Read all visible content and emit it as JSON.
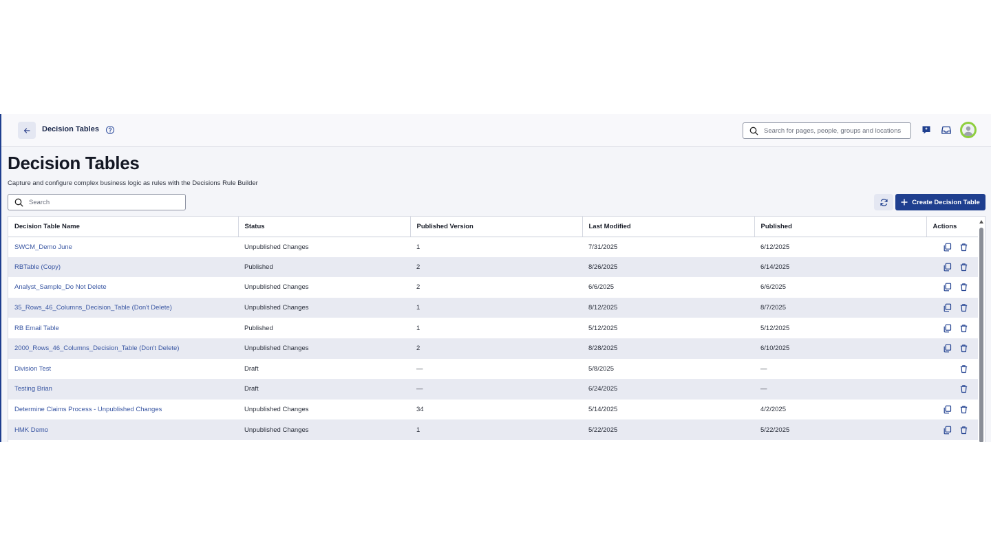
{
  "header": {
    "title": "Decision Tables",
    "search_placeholder": "Search for pages, people, groups and locations"
  },
  "page": {
    "title": "Decision Tables",
    "subtitle": "Capture and configure complex business logic as rules with the Decisions Rule Builder",
    "search_placeholder": "Search",
    "create_label": "Create Decision Table"
  },
  "table": {
    "columns": [
      "Decision Table Name",
      "Status",
      "Published Version",
      "Last Modified",
      "Published",
      "Actions"
    ],
    "rows": [
      {
        "name": "SWCM_Demo June",
        "status": "Unpublished Changes",
        "version": "1",
        "modified": "7/31/2025",
        "published": "6/12/2025",
        "copy": true
      },
      {
        "name": "RBTable (Copy)",
        "status": "Published",
        "version": "2",
        "modified": "8/26/2025",
        "published": "6/14/2025",
        "copy": true
      },
      {
        "name": "Analyst_Sample_Do Not Delete",
        "status": "Unpublished Changes",
        "version": "2",
        "modified": "6/6/2025",
        "published": "6/6/2025",
        "copy": true
      },
      {
        "name": "35_Rows_46_Columns_Decision_Table (Don't Delete)",
        "status": "Unpublished Changes",
        "version": "1",
        "modified": "8/12/2025",
        "published": "8/7/2025",
        "copy": true
      },
      {
        "name": "RB Email Table",
        "status": "Published",
        "version": "1",
        "modified": "5/12/2025",
        "published": "5/12/2025",
        "copy": true
      },
      {
        "name": "2000_Rows_46_Columns_Decision_Table (Don't Delete)",
        "status": "Unpublished Changes",
        "version": "2",
        "modified": "8/28/2025",
        "published": "6/10/2025",
        "copy": true
      },
      {
        "name": "Division Test",
        "status": "Draft",
        "version": "—",
        "modified": "5/8/2025",
        "published": "—",
        "copy": false
      },
      {
        "name": "Testing Brian",
        "status": "Draft",
        "version": "—",
        "modified": "6/24/2025",
        "published": "—",
        "copy": false
      },
      {
        "name": "Determine Claims Process - Unpublished Changes",
        "status": "Unpublished Changes",
        "version": "34",
        "modified": "5/14/2025",
        "published": "4/2/2025",
        "copy": true
      },
      {
        "name": "HMK Demo",
        "status": "Unpublished Changes",
        "version": "1",
        "modified": "5/22/2025",
        "published": "5/22/2025",
        "copy": true
      }
    ]
  },
  "colors": {
    "primary": "#1f3f8f",
    "link": "#3a57a3",
    "row_alt": "#e8eaf2",
    "avatar_ring": "#8fcf3e"
  }
}
